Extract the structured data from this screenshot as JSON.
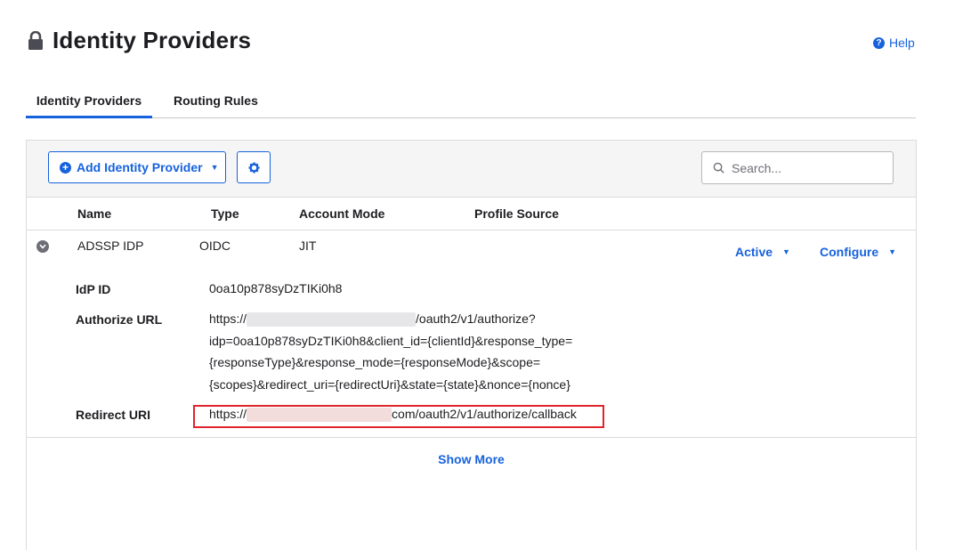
{
  "page": {
    "title": "Identity Providers",
    "help_label": "Help"
  },
  "tabs": [
    {
      "label": "Identity Providers",
      "active": true
    },
    {
      "label": "Routing Rules",
      "active": false
    }
  ],
  "toolbar": {
    "add_button_label": "Add Identity Provider",
    "search_placeholder": "Search..."
  },
  "table": {
    "columns": [
      "Name",
      "Type",
      "Account Mode",
      "Profile Source"
    ],
    "row": {
      "name": "ADSSP IDP",
      "type": "OIDC",
      "account_mode": "JIT",
      "status": "Active",
      "configure_label": "Configure"
    }
  },
  "details": {
    "idp_id_label": "IdP ID",
    "idp_id_value": "0oa10p878syDzTIKi0h8",
    "authorize_url_label": "Authorize URL",
    "authorize_url_prefix": "https://",
    "authorize_url_suffix": "/oauth2/v1/authorize?",
    "authorize_url_line2": "idp=0oa10p878syDzTIKi0h8&client_id={clientId}&response_type=",
    "authorize_url_line3": "{responseType}&response_mode={responseMode}&scope=",
    "authorize_url_line4": "{scopes}&redirect_uri={redirectUri}&state={state}&nonce={nonce}",
    "redirect_uri_label": "Redirect URI",
    "redirect_uri_prefix": "https://",
    "redirect_uri_suffix": "com/oauth2/v1/authorize/callback"
  },
  "show_more_label": "Show More",
  "colors": {
    "accent": "#1662dd",
    "highlight": "#e0252d"
  },
  "icons": [
    "lock-icon",
    "help-icon",
    "plus-circle-icon",
    "gear-icon",
    "search-icon",
    "chevron-down-icon"
  ]
}
